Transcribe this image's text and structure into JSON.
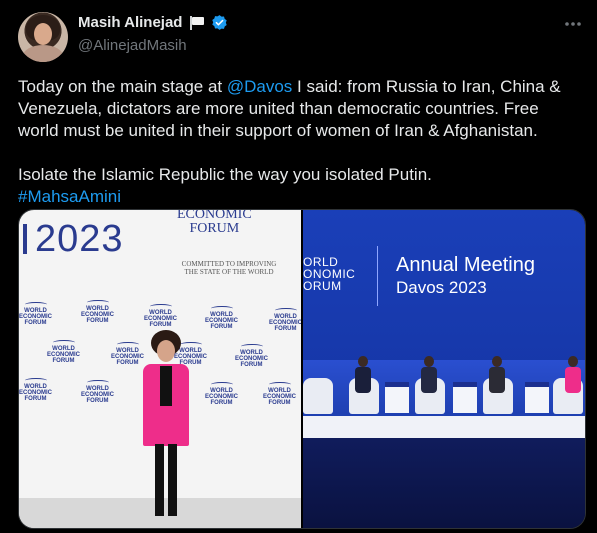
{
  "author": {
    "display_name": "Masih Alinejad",
    "handle": "@AlinejadMasih",
    "flag_emoji": "🏳️",
    "verified": true
  },
  "tweet": {
    "line1_before": "Today on the main stage at ",
    "mention": "@Davos",
    "line1_after": " I said: from Russia to Iran, China & Venezuela, dictators are more united than democratic countries. Free world must be united in their support of women of Iran & Afghanistan.",
    "line2": "Isolate the Islamic Republic the way you isolated Putin.",
    "hashtag": "#MahsaAmini"
  },
  "media": {
    "left_photo": {
      "year_text": "2023",
      "wef_text_line1": "ECONOMIC",
      "wef_text_line2": "FORUM",
      "committed_text": "COMMITTED TO IMPROVING THE STATE OF THE WORLD",
      "logo_small_line1": "WORLD",
      "logo_small_line2": "ECONOMIC",
      "logo_small_line3": "FORUM"
    },
    "right_photo": {
      "wef_line1": "ORLD",
      "wef_line2": "ONOMIC",
      "wef_line3": "ORUM",
      "title": "Annual Meeting",
      "subtitle": "Davos 2023"
    }
  },
  "colors": {
    "background": "#000000",
    "text": "#e7e9ea",
    "secondary": "#71767b",
    "link": "#1d9bf0",
    "verified": "#1d9bf0"
  },
  "icons": {
    "more": "more-horizontal-icon",
    "verified": "verified-badge-icon",
    "flag": "white-flag-icon"
  }
}
